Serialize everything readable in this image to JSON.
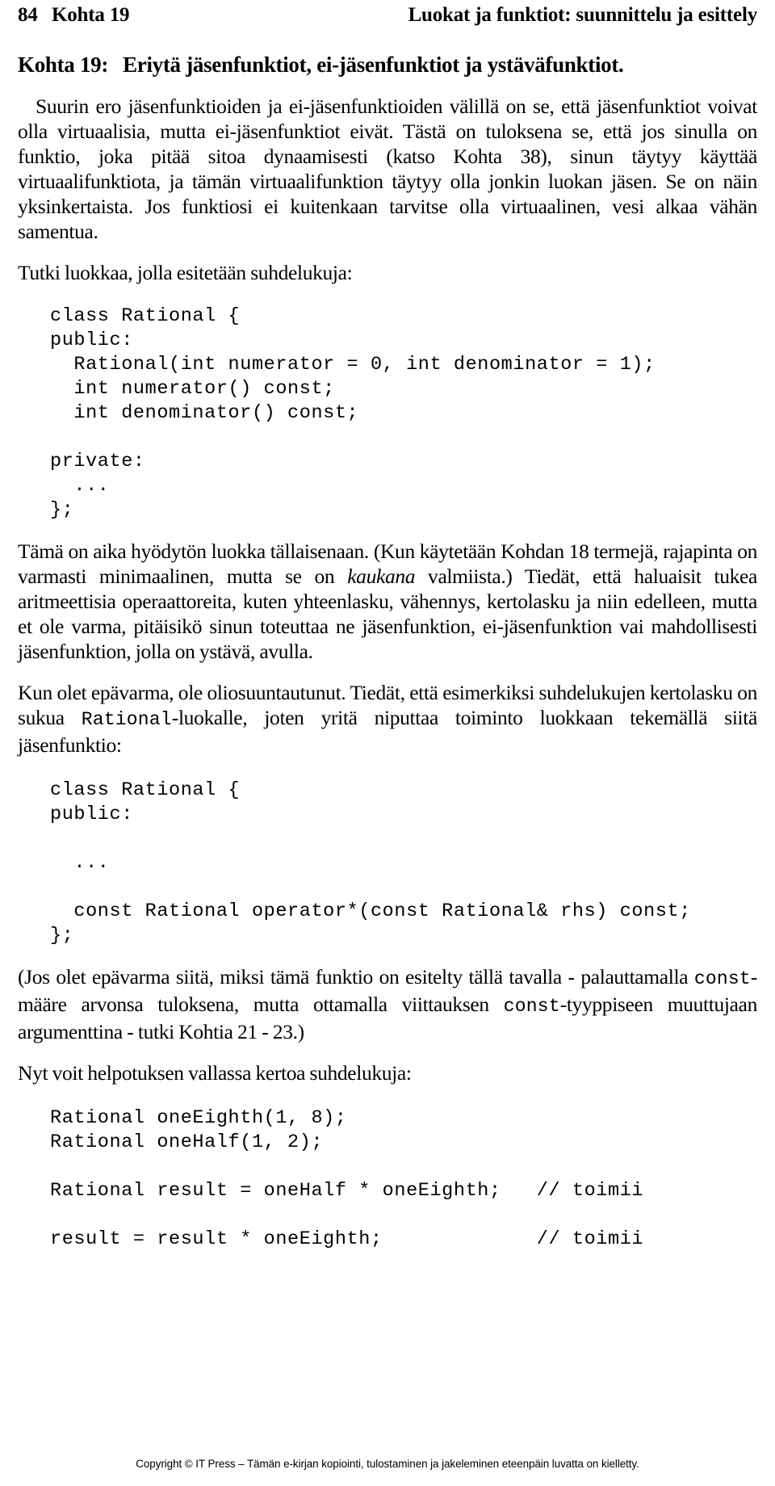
{
  "running_head": {
    "page_number": "84",
    "section": "Kohta 19",
    "title": "Luokat ja funktiot: suunnittelu ja esittely"
  },
  "heading": {
    "label": "Kohta 19:",
    "text": "Eriytä jäsenfunktiot, ei-jäsenfunktiot ja ystäväfunktiot."
  },
  "paragraphs": {
    "p1": "Suurin ero jäsenfunktioiden ja ei-jäsenfunktioiden välillä on se, että jäsenfunktiot voivat olla virtuaalisia, mutta ei-jäsenfunktiot eivät. Tästä on tuloksena se, että jos sinulla on funktio, joka pitää sitoa dynaamisesti (katso Kohta 38), sinun täytyy käyttää virtuaalifunktiota, ja tämän virtuaalifunktion täytyy olla jonkin luokan jäsen. Se on näin yksinkertaista. Jos funktiosi ei kuitenkaan tarvitse olla virtuaalinen, vesi alkaa vähän samentua.",
    "p2": "Tutki luokkaa, jolla esitetään suhdelukuja:",
    "p3_part1": "Tämä on aika hyödytön luokka tällaisenaan. (Kun käytetään Kohdan 18 termejä, rajapinta on varmasti minimaalinen, mutta se on ",
    "p3_italic": "kaukana",
    "p3_part2": " valmiista.) Tiedät, että haluaisit tukea aritmeettisia operaattoreita, kuten yhteenlasku, vähennys, kertolasku ja niin edelleen, mutta et ole varma, pitäisikö sinun toteuttaa ne jäsenfunktion, ei-jäsenfunktion vai mahdollisesti jäsenfunktion, jolla on ystävä, avulla.",
    "p4_part1": "Kun olet epävarma, ole oliosuuntautunut. Tiedät, että esimerkiksi suhdelukujen kertolasku on sukua ",
    "p4_code": "Rational",
    "p4_part2": "-luokalle, joten yritä niputtaa toiminto luokkaan tekemällä siitä jäsenfunktio:",
    "p5_part1": "(Jos olet epävarma siitä, miksi tämä funktio on esitelty tällä tavalla - palauttamalla ",
    "p5_code1": "const",
    "p5_part2": "-määre arvonsa tuloksena, mutta ottamalla viittauksen ",
    "p5_code2": "const",
    "p5_part3": "-tyyppiseen muuttujaan argumenttina - tutki Kohtia 21 - 23.)",
    "p6": "Nyt voit helpotuksen vallassa kertoa suhdelukuja:"
  },
  "code_blocks": {
    "block1": "class Rational {\npublic:\n  Rational(int numerator = 0, int denominator = 1);\n  int numerator() const;\n  int denominator() const;\n\nprivate:\n  ...\n};",
    "block2": "class Rational {\npublic:\n\n  ...\n\n  const Rational operator*(const Rational& rhs) const;\n};",
    "block3": "Rational oneEighth(1, 8);\nRational oneHalf(1, 2);\n\nRational result = oneHalf * oneEighth;   // toimii\n\nresult = result * oneEighth;             // toimii"
  },
  "footer": {
    "text": "Copyright © IT Press – Tämän e-kirjan kopiointi, tulostaminen ja jakeleminen eteenpäin luvatta on kielletty."
  }
}
